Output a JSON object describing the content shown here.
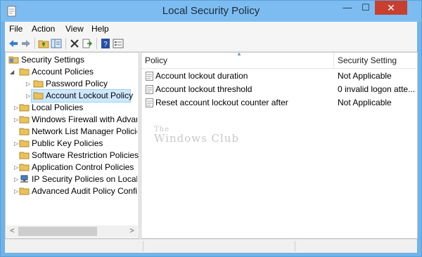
{
  "window": {
    "title": "Local Security Policy",
    "controls": {
      "minimize": "—",
      "maximize": "☐",
      "close": "✕"
    }
  },
  "menubar": {
    "items": [
      {
        "label": "File"
      },
      {
        "label": "Action"
      },
      {
        "label": "View"
      },
      {
        "label": "Help"
      }
    ]
  },
  "toolbar": {
    "buttons": [
      {
        "icon": "back-arrow-icon"
      },
      {
        "icon": "forward-arrow-icon"
      },
      {
        "icon": "up-folder-icon"
      },
      {
        "icon": "show-hide-tree-icon"
      },
      {
        "icon": "delete-icon"
      },
      {
        "icon": "export-list-icon"
      },
      {
        "icon": "help-icon"
      },
      {
        "icon": "properties-icon"
      }
    ]
  },
  "tree": {
    "items": [
      {
        "label": "Security Settings"
      },
      {
        "label": "Account Policies"
      },
      {
        "label": "Password Policy"
      },
      {
        "label": "Account Lockout Policy",
        "selected": true
      },
      {
        "label": "Local Policies"
      },
      {
        "label": "Windows Firewall with Advanc"
      },
      {
        "label": "Network List Manager Policies"
      },
      {
        "label": "Public Key Policies"
      },
      {
        "label": "Software Restriction Policies"
      },
      {
        "label": "Application Control Policies"
      },
      {
        "label": "IP Security Policies on Local C"
      },
      {
        "label": "Advanced Audit Policy Config"
      }
    ],
    "expanders": {
      "collapsed": "▷",
      "expanded": "◢"
    },
    "scroll": {
      "left": "<",
      "right": ">"
    }
  },
  "list": {
    "columns": {
      "policy": "Policy",
      "setting": "Security Setting"
    },
    "sort_indicator": "▲",
    "rows": [
      {
        "policy": "Account lockout duration",
        "setting": "Not Applicable"
      },
      {
        "policy": "Account lockout threshold",
        "setting": "0 invalid logon atte..."
      },
      {
        "policy": "Reset account lockout counter after",
        "setting": "Not Applicable"
      }
    ],
    "watermark": {
      "line1": "The",
      "line2": "Windows Club"
    }
  },
  "colors": {
    "accent": "#7cbcf0",
    "selection": "#cde8ff",
    "close": "#c7402f"
  }
}
